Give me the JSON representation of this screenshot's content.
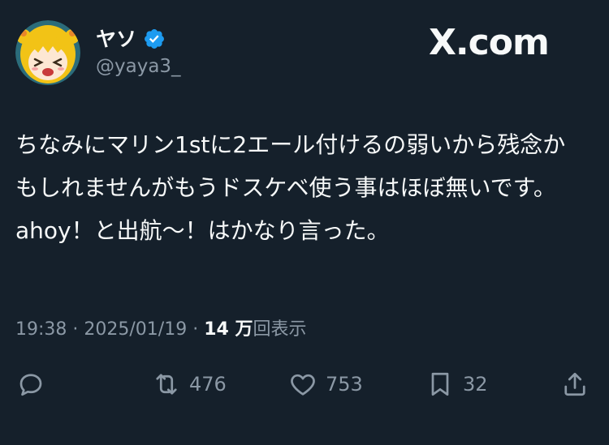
{
  "user": {
    "display_name": "ヤソ",
    "handle": "@yaya3_",
    "verified": true,
    "avatar_icon": "anime-girl-avatar"
  },
  "watermark": "X.com",
  "tweet": {
    "text": "ちなみにマリン1stに2エール付けるの弱いから残念かもしれませんがもうドスケベ使う事はほぼ無いです。\nahoy！と出航〜！はかなり言った。"
  },
  "meta": {
    "time": "19:38",
    "separator": " · ",
    "date": "2025/01/19",
    "views_count": "14 万",
    "views_label": "回表示"
  },
  "actions": {
    "reply_icon": "speech-bubble-icon",
    "retweet_count": "476",
    "like_count": "753",
    "bookmark_count": "32",
    "share_icon": "upload-icon"
  },
  "colors": {
    "background": "#15202b",
    "text_primary": "#f7f9f9",
    "text_secondary": "#8b98a5",
    "verified_blue": "#1d9bf0",
    "avatar_yellow": "#f5c518"
  }
}
